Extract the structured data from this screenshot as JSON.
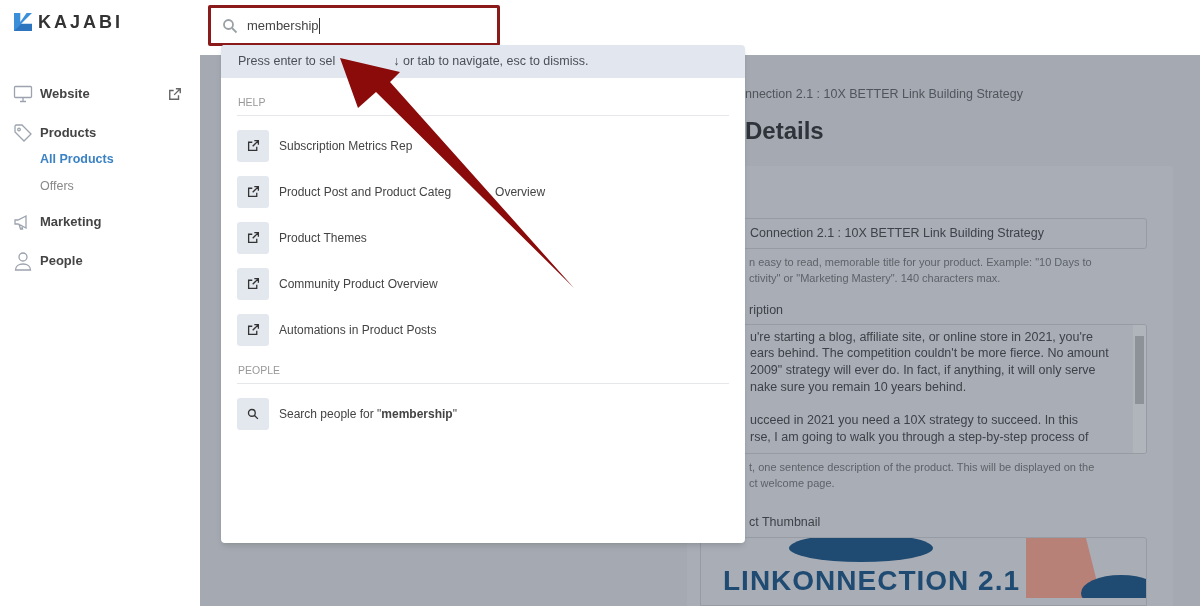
{
  "logo": {
    "text": "KAJABI"
  },
  "sidebar": {
    "items": [
      {
        "label": "Website"
      },
      {
        "label": "Products",
        "children": [
          {
            "label": "All Products",
            "selected": true
          },
          {
            "label": "Offers",
            "selected": false
          }
        ]
      },
      {
        "label": "Marketing"
      },
      {
        "label": "People"
      }
    ]
  },
  "search": {
    "value": "membership"
  },
  "dropdown": {
    "hint": [
      "Press enter to sel",
      "↓ or tab to navigate, esc to dismiss."
    ],
    "sections": [
      {
        "title": "HELP",
        "results": [
          {
            "kind": "article",
            "label": [
              "Subscription Metrics Rep"
            ]
          },
          {
            "kind": "article",
            "label": [
              "Product Post and Product Categ",
              "Overview"
            ]
          },
          {
            "kind": "article",
            "label": [
              "Product Themes"
            ]
          },
          {
            "kind": "article",
            "label": [
              "Community Product Overview"
            ]
          },
          {
            "kind": "article",
            "label": [
              "Automations in Product Posts"
            ]
          }
        ]
      },
      {
        "title": "PEOPLE",
        "results": [
          {
            "kind": "search",
            "label": [
              "Search people for \"**membership**\""
            ]
          }
        ]
      }
    ]
  },
  "main": {
    "breadcrumb": "nnection 2.1 : 10X BETTER Link Building Strategy",
    "heading": "Details",
    "title_field": {
      "value": "Connection 2.1 : 10X BETTER Link Building Strategy"
    },
    "title_help": [
      "n easy to read, memorable title for your product. Example: \"10 Days to",
      "ctivity\" or \"Marketing Mastery\". 140 characters max."
    ],
    "description_label": "ription",
    "description_lines": [
      "u're starting a blog, affiliate site, or online store in 2021, you're",
      "ears behind. The competition couldn't be more fierce. No amount",
      "2009\" strategy will ever do. In fact, if anything, it will only serve",
      "nake sure you remain 10 years behind.",
      "ucceed in 2021 you need a 10X strategy to succeed. In this",
      "rse, I am going to walk you through a step-by-step process of"
    ],
    "description_help": [
      "t, one sentence description of the product. This will be displayed on the",
      "ct welcome page."
    ],
    "thumbnail_label": "ct Thumbnail",
    "thumbnail_text": "LINKONNECTION 2.1"
  }
}
